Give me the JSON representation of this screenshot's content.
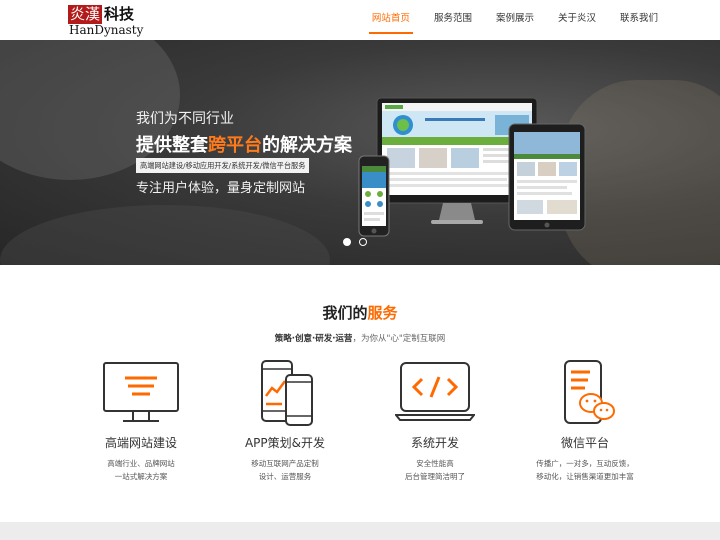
{
  "header": {
    "logo": {
      "cn_red": "炎漢",
      "cn_black": "科技",
      "en": "HanDynasty"
    },
    "nav": [
      {
        "label": "网站首页",
        "active": true
      },
      {
        "label": "服务范围",
        "active": false
      },
      {
        "label": "案例展示",
        "active": false
      },
      {
        "label": "关于炎汉",
        "active": false
      },
      {
        "label": "联系我们",
        "active": false
      }
    ]
  },
  "banner": {
    "line1": "我们为不同行业",
    "line2_before": "提供整套",
    "line2_highlight": "跨平台",
    "line2_after": "的解决方案",
    "tag": "高端网站建设/移动应用开发/系统开发/微信平台服务",
    "line3": "专注用户体验，量身定制网站",
    "slides_total": 2,
    "slide_active": 1
  },
  "services": {
    "title_before": "我们的",
    "title_highlight": "服务",
    "sub_bold": "策略·创意·研发·运营",
    "sub_rest": "，为你从\"心\"定制互联网",
    "items": [
      {
        "icon": "monitor-icon",
        "name": "高端网站建设",
        "desc1": "高端行业、品牌网站",
        "desc2": "一站式解决方案"
      },
      {
        "icon": "mobile-phones-icon",
        "name": "APP策划&开发",
        "desc1": "移动互联网产品定制",
        "desc2": "设计、运营服务"
      },
      {
        "icon": "code-laptop-icon",
        "name": "系统开发",
        "desc1": "安全性能高",
        "desc2": "后台管理简洁明了"
      },
      {
        "icon": "wechat-phone-icon",
        "name": "微信平台",
        "desc1": "传播广，一对多，互动反馈，",
        "desc2": "移动化，让销售渠道更加丰富"
      }
    ]
  },
  "colors": {
    "accent": "#ff6a00",
    "logo_red": "#b31b1b",
    "text": "#333333"
  }
}
